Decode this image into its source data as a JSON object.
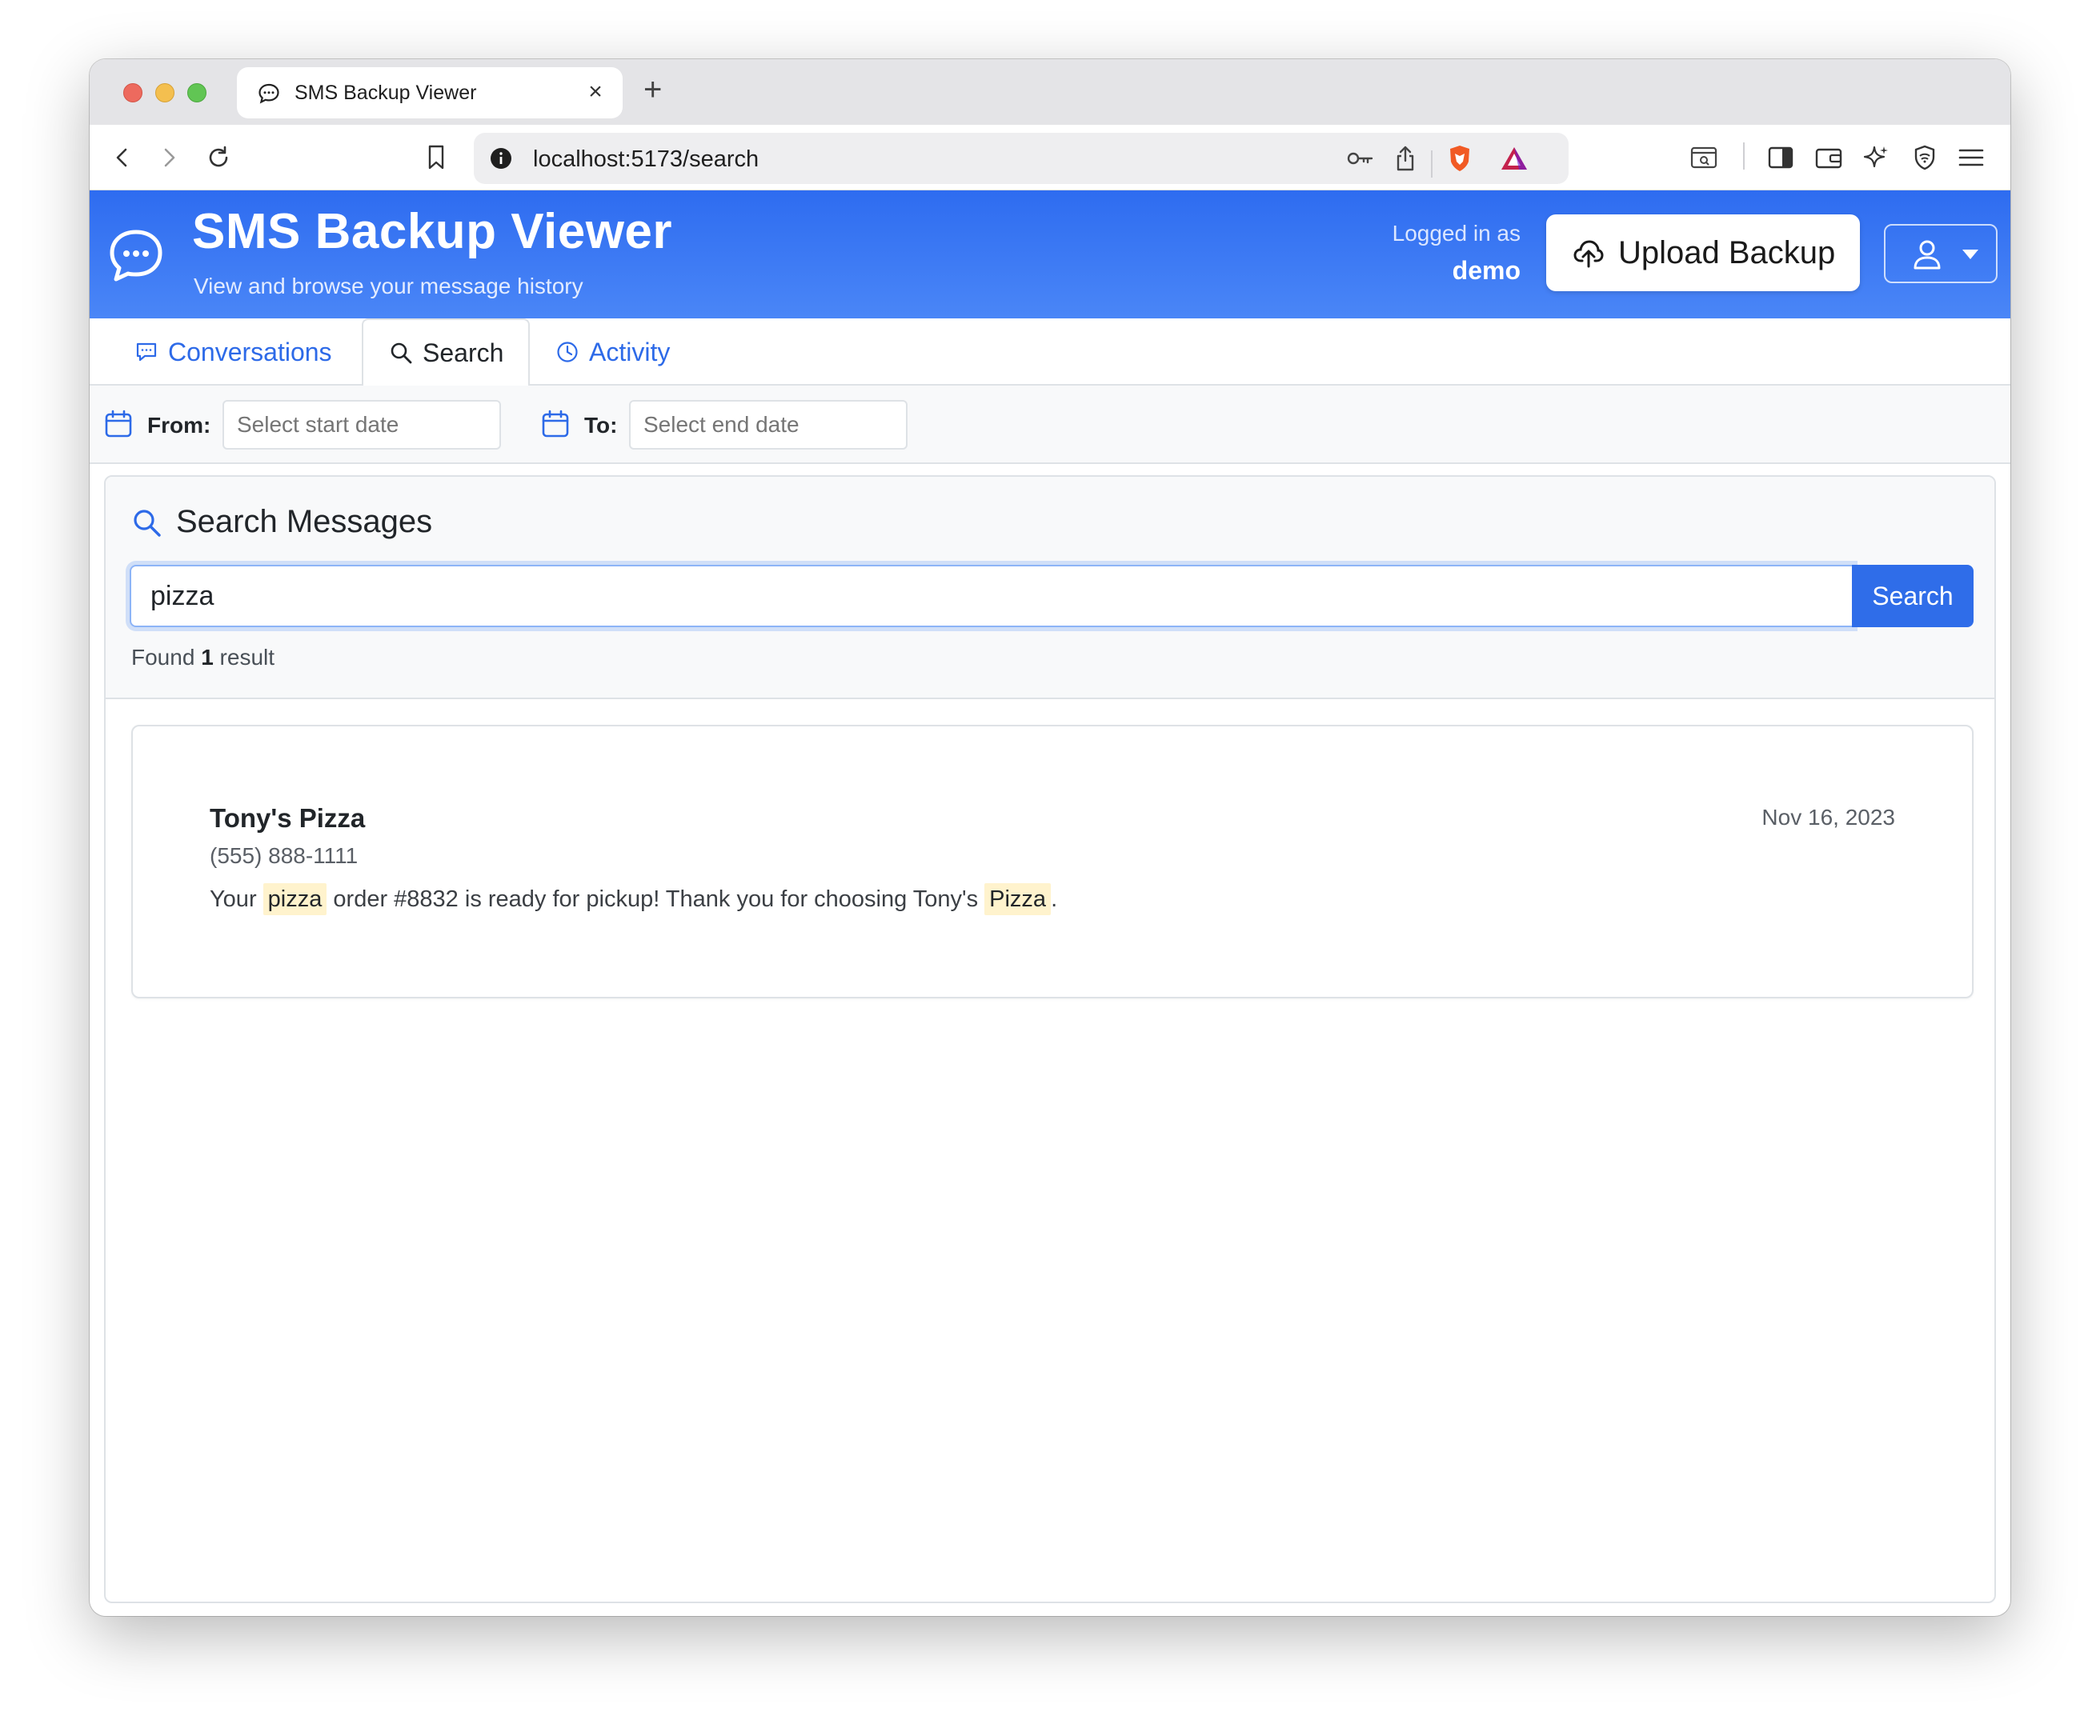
{
  "browser": {
    "tab_title": "SMS Backup Viewer",
    "tab_close": "×",
    "new_tab": "+",
    "url": "localhost:5173/search"
  },
  "header": {
    "title": "SMS Backup Viewer",
    "subtitle": "View and browse your message history",
    "logged_in_label": "Logged in as",
    "username": "demo",
    "upload_label": "Upload Backup"
  },
  "tabs": [
    {
      "label": "Conversations",
      "active": false
    },
    {
      "label": "Search",
      "active": true
    },
    {
      "label": "Activity",
      "active": false
    }
  ],
  "filters": {
    "from_label": "From:",
    "from_placeholder": "Select start date",
    "to_label": "To:",
    "to_placeholder": "Select end date"
  },
  "search": {
    "title": "Search Messages",
    "query": "pizza",
    "button_label": "Search",
    "found_prefix": "Found",
    "found_count": "1",
    "found_suffix": "result"
  },
  "results": [
    {
      "name": "Tony's Pizza",
      "phone": "(555) 888-1111",
      "date": "Nov 16, 2023",
      "body_parts": [
        "Your ",
        "pizza",
        " order #8832 is ready for pickup! Thank you for choosing Tony's ",
        "Pizza",
        "."
      ]
    }
  ],
  "colors": {
    "accent": "#2f6de9",
    "header_gradient_top": "#2e6cf0",
    "highlight": "#fff3cd"
  }
}
